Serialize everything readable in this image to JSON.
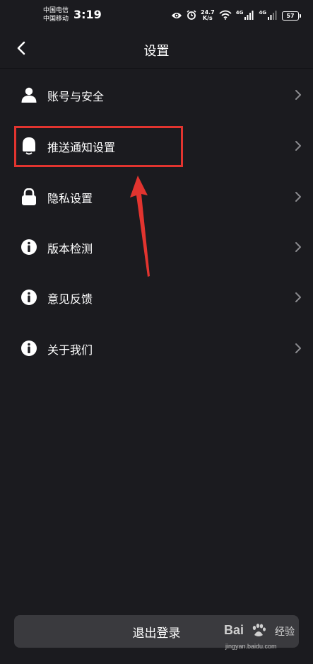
{
  "status_bar": {
    "carrier_1": "中国电信",
    "carrier_2": "中国移动",
    "time": "3:19",
    "net_speed_value": "24.7",
    "net_speed_unit": "K/s",
    "signal_1_label": "4G",
    "signal_2_label": "4G",
    "battery": "57"
  },
  "header": {
    "title": "设置"
  },
  "menu": {
    "items": [
      {
        "label": "账号与安全",
        "icon": "user-icon"
      },
      {
        "label": "推送通知设置",
        "icon": "bell-icon"
      },
      {
        "label": "隐私设置",
        "icon": "lock-icon"
      },
      {
        "label": "版本检测",
        "icon": "info-icon"
      },
      {
        "label": "意见反馈",
        "icon": "info-icon"
      },
      {
        "label": "关于我们",
        "icon": "info-icon"
      }
    ]
  },
  "footer": {
    "logout_label": "退出登录"
  },
  "watermark": {
    "brand": "Bai",
    "brand_suffix": "经验",
    "url": "jingyan.baidu.com"
  },
  "colors": {
    "background": "#1b1b1f",
    "logout_button": "#3a3a3e",
    "annotation_red": "#e2342f",
    "chevron": "#8a8a8e"
  }
}
